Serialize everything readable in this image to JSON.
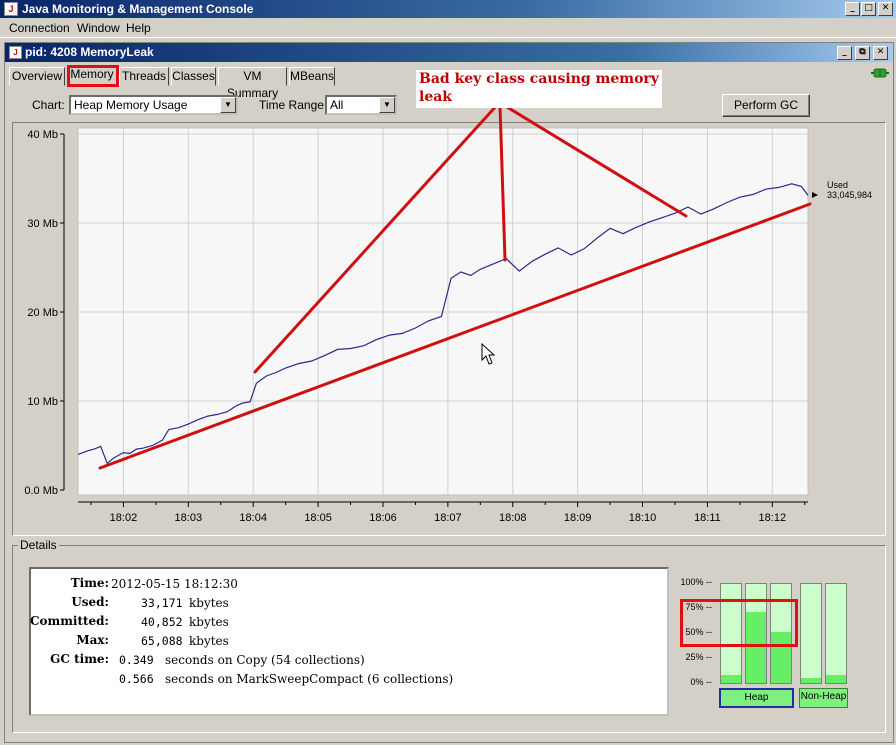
{
  "window": {
    "title": "Java Monitoring & Management Console"
  },
  "menu": [
    "Connection",
    "Window",
    "Help"
  ],
  "inner_window": {
    "title": "pid: 4208 MemoryLeak"
  },
  "tabs": [
    "Overview",
    "Memory",
    "Threads",
    "Classes",
    "VM Summary",
    "MBeans"
  ],
  "active_tab": "Memory",
  "toolbar": {
    "chart_label": "Chart:",
    "chart_value": "Heap Memory Usage",
    "time_range_label": "Time Range:",
    "time_range_value": "All",
    "perform_gc": "Perform GC"
  },
  "annotation": {
    "text": "Bad key class causing memory leak",
    "color": "#c00000"
  },
  "chart_data": {
    "type": "line",
    "y_ticks": [
      "40 Mb",
      "30 Mb",
      "20 Mb",
      "10 Mb",
      "0.0 Mb"
    ],
    "x_ticks": [
      "18:02",
      "18:03",
      "18:04",
      "18:05",
      "18:06",
      "18:07",
      "18:08",
      "18:09",
      "18:10",
      "18:11",
      "18:12"
    ],
    "ylim": [
      0,
      40
    ],
    "xlim_minutes": [
      1.3,
      12.55
    ],
    "series": [
      {
        "color": "#2a2a8c",
        "x": [
          1.3,
          1.45,
          1.55,
          1.65,
          1.75,
          1.85,
          2.0,
          2.1,
          2.2,
          2.3,
          2.45,
          2.6,
          2.7,
          2.85,
          3.0,
          3.15,
          3.3,
          3.45,
          3.6,
          3.75,
          3.85,
          3.95,
          4.05,
          4.2,
          4.35,
          4.5,
          4.7,
          4.9,
          5.1,
          5.3,
          5.5,
          5.7,
          5.9,
          6.1,
          6.3,
          6.5,
          6.7,
          6.9,
          7.05,
          7.2,
          7.35,
          7.5,
          7.7,
          7.9,
          8.1,
          8.3,
          8.5,
          8.7,
          8.9,
          9.1,
          9.3,
          9.5,
          9.7,
          9.9,
          10.1,
          10.3,
          10.5,
          10.7,
          10.9,
          11.1,
          11.3,
          11.5,
          11.7,
          11.9,
          12.1,
          12.3,
          12.45,
          12.55
        ],
        "y": [
          4.0,
          4.4,
          4.6,
          4.9,
          3.0,
          3.6,
          4.2,
          4.1,
          4.6,
          4.7,
          5.0,
          5.6,
          6.8,
          7.0,
          7.4,
          7.9,
          8.3,
          8.5,
          8.8,
          9.5,
          9.8,
          9.9,
          12.0,
          12.8,
          13.2,
          13.7,
          14.2,
          14.5,
          15.1,
          15.8,
          15.9,
          16.2,
          16.9,
          17.4,
          17.6,
          18.2,
          19.0,
          19.5,
          23.8,
          24.5,
          24.1,
          24.8,
          25.4,
          26.0,
          24.6,
          25.7,
          26.5,
          27.2,
          26.4,
          27.1,
          28.3,
          29.4,
          28.8,
          29.5,
          30.1,
          30.6,
          31.1,
          31.8,
          31.0,
          31.6,
          32.3,
          32.9,
          33.2,
          33.8,
          34.0,
          34.4,
          34.1,
          33.1
        ]
      }
    ],
    "current_label": "Used",
    "current_value": "33,045,984"
  },
  "details": {
    "legend": "Details",
    "rows": [
      {
        "label": "Time:",
        "value": "2012-05-15 18:12:30"
      },
      {
        "label": "Used:",
        "value": "33,171",
        "unit": "kbytes"
      },
      {
        "label": "Committed:",
        "value": "40,852",
        "unit": "kbytes"
      },
      {
        "label": "Max:",
        "value": "65,088",
        "unit": "kbytes"
      },
      {
        "label": "GC time:",
        "value": "0.349",
        "unit": "seconds on Copy (54 collections)"
      },
      {
        "label": "",
        "value": "0.566",
        "unit": "seconds on MarkSweepCompact (6 collections)"
      }
    ]
  },
  "usage_bars": {
    "pct_labels": [
      "100% --",
      "75% --",
      "50% --",
      "25% --",
      "0% --"
    ],
    "heap_fill": [
      0.08,
      0.72,
      0.52
    ],
    "non_heap_fill": [
      0.05,
      0.08
    ],
    "heap_label": "Heap",
    "non_heap_label": "Non-Heap"
  }
}
